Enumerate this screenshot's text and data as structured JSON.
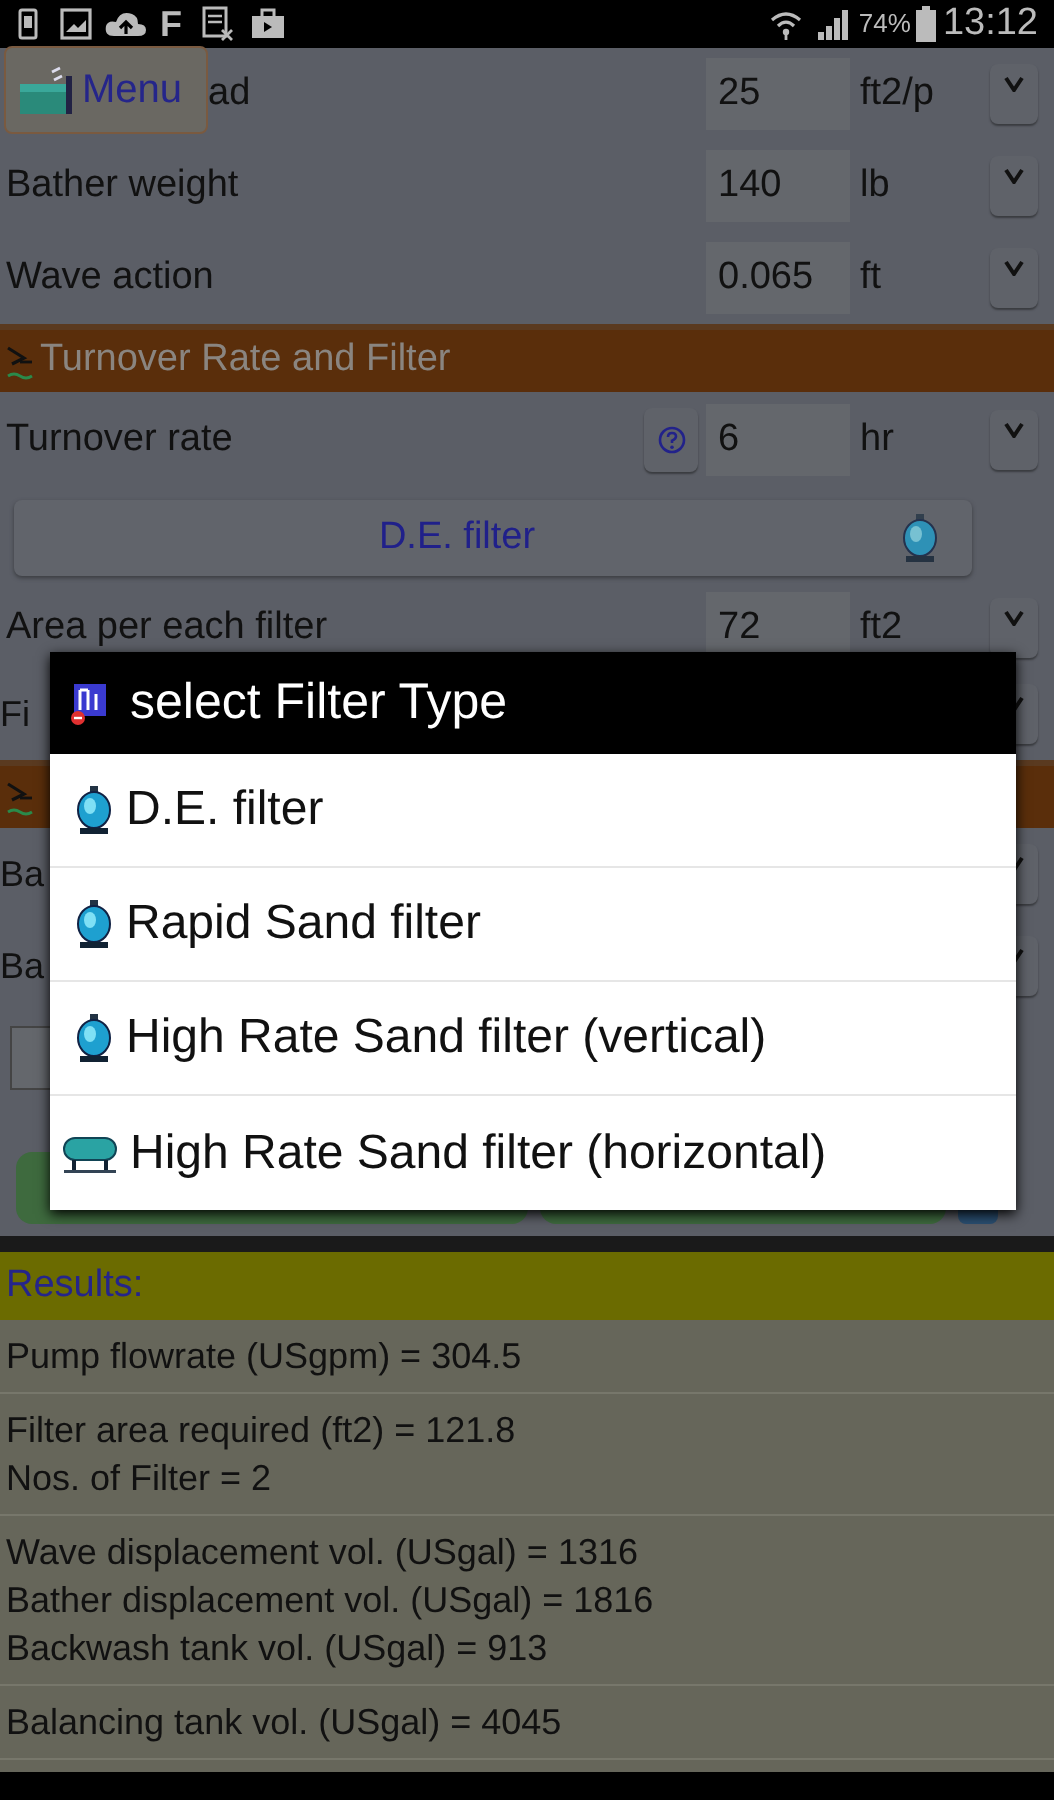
{
  "status_bar": {
    "app_glyph": "F",
    "battery": "74%",
    "time": "13:12"
  },
  "menu_button": {
    "label": "Menu"
  },
  "inputs": [
    {
      "label": "ad",
      "value": "25",
      "unit": "ft2/p"
    },
    {
      "label": "Bather weight",
      "value": "140",
      "unit": "lb"
    },
    {
      "label": "Wave action",
      "value": "0.065",
      "unit": "ft"
    }
  ],
  "section": {
    "title": "Turnover Rate and Filter"
  },
  "turnover": {
    "label": "Turnover rate",
    "value": "6",
    "unit": "hr"
  },
  "filter_button": {
    "label": "D.E. filter"
  },
  "obscured_rows": [
    {
      "kind": "input",
      "label": "Area per each filter",
      "value": "72",
      "unit": "ft2"
    },
    {
      "kind": "input",
      "label": "Fi"
    },
    {
      "kind": "section"
    },
    {
      "kind": "input",
      "label": "Ba"
    },
    {
      "kind": "input",
      "label": "Ba"
    },
    {
      "kind": "field"
    },
    {
      "kind": "buttons"
    }
  ],
  "dialog": {
    "title": "select Filter Type",
    "options": [
      {
        "label": "D.E. filter",
        "kind": "vertical"
      },
      {
        "label": "Rapid Sand filter",
        "kind": "vertical"
      },
      {
        "label": "High Rate Sand filter (vertical)",
        "kind": "vertical"
      },
      {
        "label": "High Rate Sand filter (horizontal)",
        "kind": "horizontal"
      }
    ]
  },
  "results": {
    "title": "Results:",
    "groups": [
      [
        "Pump flowrate (USgpm) = 304.5"
      ],
      [
        "Filter area required (ft2) = 121.8",
        "Nos. of Filter = 2"
      ],
      [
        "Wave displacement vol. (USgal) = 1316",
        "Bather displacement vol. (USgal) = 1816",
        "Backwash tank vol. (USgal) = 913"
      ],
      [
        "Balancing tank vol. (USgal) = 4045"
      ]
    ]
  }
}
